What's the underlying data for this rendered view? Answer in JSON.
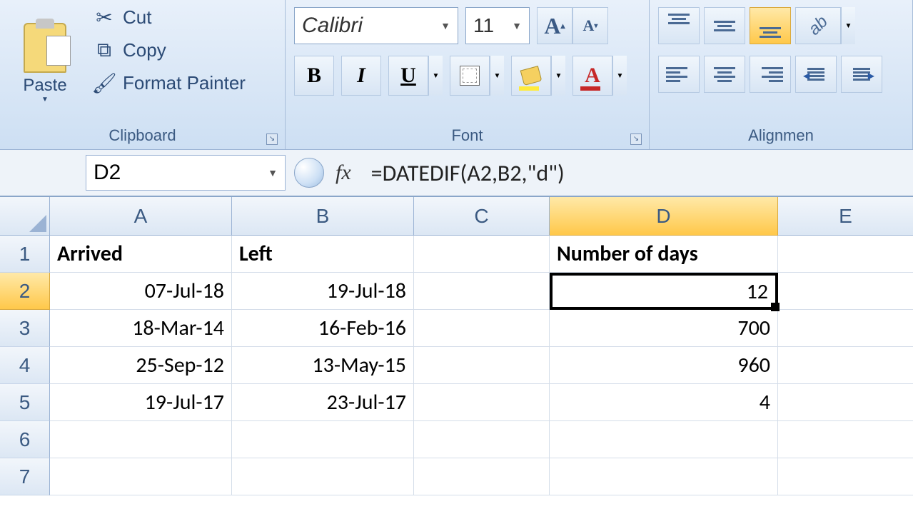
{
  "ribbon": {
    "clipboard": {
      "label": "Clipboard",
      "paste": "Paste",
      "cut": "Cut",
      "copy": "Copy",
      "format_painter": "Format Painter"
    },
    "font": {
      "label": "Font",
      "name": "Calibri",
      "size": "11"
    },
    "alignment": {
      "label": "Alignmen"
    }
  },
  "formula_bar": {
    "cell_ref": "D2",
    "fx": "fx",
    "formula": "=DATEDIF(A2,B2,\"d\")"
  },
  "columns": [
    "A",
    "B",
    "C",
    "D",
    "E"
  ],
  "rows": [
    "1",
    "2",
    "3",
    "4",
    "5",
    "6",
    "7"
  ],
  "headers": {
    "A": "Arrived",
    "B": "Left",
    "D": "Number of days"
  },
  "data": [
    {
      "A": "07-Jul-18",
      "B": "19-Jul-18",
      "D": "12"
    },
    {
      "A": "18-Mar-14",
      "B": "16-Feb-16",
      "D": "700"
    },
    {
      "A": "25-Sep-12",
      "B": "13-May-15",
      "D": "960"
    },
    {
      "A": "19-Jul-17",
      "B": "23-Jul-17",
      "D": "4"
    }
  ],
  "selected": {
    "row": 2,
    "col": "D"
  }
}
